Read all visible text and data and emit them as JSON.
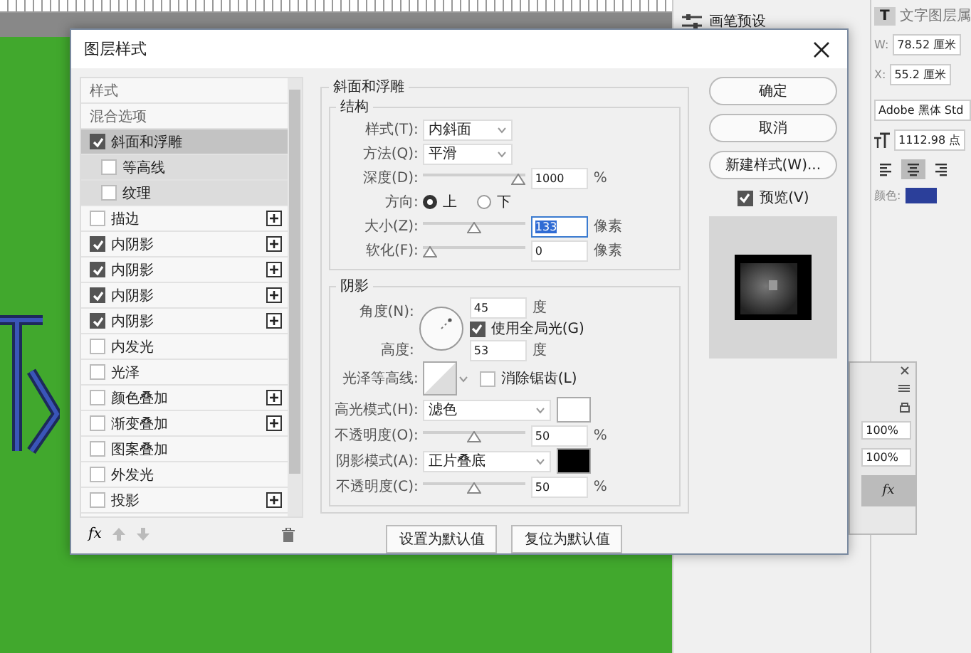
{
  "brush_panel": {
    "title": "画笔预设"
  },
  "properties": {
    "type_icon": "T",
    "title": "文字图层属",
    "w_label": "W:",
    "w_value": "78.52 厘米",
    "x_label": "X:",
    "x_value": "55.2 厘米",
    "font": "Adobe 黑体 Std",
    "size": "1112.98 点",
    "align": [
      {
        "kind": "left",
        "selected": false
      },
      {
        "kind": "center",
        "selected": true
      },
      {
        "kind": "right",
        "selected": false
      }
    ],
    "color_label": "颜色:",
    "color": "#2b3f9a"
  },
  "layers_panel": {
    "opacity": "100%",
    "fill": "100%",
    "fx": "fx"
  },
  "dialog": {
    "title": "图层样式",
    "styles": [
      {
        "kind": "header",
        "label": "样式",
        "selected": false
      },
      {
        "kind": "header",
        "label": "混合选项",
        "selected": false
      },
      {
        "kind": "effect",
        "label": "斜面和浮雕",
        "checked": true,
        "selected": true,
        "add_button": false,
        "children": [
          {
            "kind": "effect",
            "label": "等高线",
            "checked": false,
            "selected": false,
            "add_button": false
          },
          {
            "kind": "effect",
            "label": "纹理",
            "checked": false,
            "selected": false,
            "add_button": false
          }
        ]
      },
      {
        "kind": "effect",
        "label": "描边",
        "checked": false,
        "selected": false,
        "add_button": true
      },
      {
        "kind": "effect",
        "label": "内阴影",
        "checked": true,
        "selected": false,
        "add_button": true
      },
      {
        "kind": "effect",
        "label": "内阴影",
        "checked": true,
        "selected": false,
        "add_button": true
      },
      {
        "kind": "effect",
        "label": "内阴影",
        "checked": true,
        "selected": false,
        "add_button": true
      },
      {
        "kind": "effect",
        "label": "内阴影",
        "checked": true,
        "selected": false,
        "add_button": true
      },
      {
        "kind": "effect",
        "label": "内发光",
        "checked": false,
        "selected": false,
        "add_button": false
      },
      {
        "kind": "effect",
        "label": "光泽",
        "checked": false,
        "selected": false,
        "add_button": false
      },
      {
        "kind": "effect",
        "label": "颜色叠加",
        "checked": false,
        "selected": false,
        "add_button": true
      },
      {
        "kind": "effect",
        "label": "渐变叠加",
        "checked": false,
        "selected": false,
        "add_button": true
      },
      {
        "kind": "effect",
        "label": "图案叠加",
        "checked": false,
        "selected": false,
        "add_button": false
      },
      {
        "kind": "effect",
        "label": "外发光",
        "checked": false,
        "selected": false,
        "add_button": false
      },
      {
        "kind": "effect",
        "label": "投影",
        "checked": false,
        "selected": false,
        "add_button": true
      }
    ],
    "list_footer": {
      "fx": "fx"
    },
    "bevel": {
      "title": "斜面和浮雕",
      "groups": [
        {
          "title": "结构",
          "rows": [
            {
              "kind": "select",
              "label": "样式(T):",
              "value": "内斜面"
            },
            {
              "kind": "select",
              "label": "方法(Q):",
              "value": "平滑"
            },
            {
              "kind": "slider",
              "label": "深度(D):",
              "level": 1,
              "value": "1000",
              "unit": "%",
              "highlighted": false
            },
            {
              "kind": "radio",
              "label": "方向:",
              "options": [
                {
                  "label": "上",
                  "selected": true
                },
                {
                  "label": "下",
                  "selected": false
                }
              ]
            },
            {
              "kind": "slider",
              "label": "大小(Z):",
              "level": 0.5,
              "value": "133",
              "unit": "像素",
              "highlighted": true
            },
            {
              "kind": "slider",
              "label": "软化(F):",
              "level": 0,
              "value": "0",
              "unit": "像素",
              "highlighted": false
            }
          ]
        },
        {
          "title": "阴影",
          "rows": [
            {
              "kind": "angle",
              "label": "角度(N):",
              "value": "45",
              "unit": "度",
              "checkbox": {
                "label": "使用全局光(G)",
                "checked": true
              },
              "altitude_label": "高度:",
              "altitude": "53",
              "altitude_unit": "度"
            },
            {
              "kind": "contour",
              "label": "光泽等高线:",
              "checkbox": {
                "label": "消除锯齿(L)",
                "checked": false
              }
            },
            {
              "kind": "select_swatch",
              "label": "高光模式(H):",
              "value": "滤色",
              "color": "#ffffff"
            },
            {
              "kind": "slider",
              "label": "不透明度(O):",
              "level": 0.5,
              "value": "50",
              "unit": "%",
              "highlighted": false
            },
            {
              "kind": "select_swatch",
              "label": "阴影模式(A):",
              "value": "正片叠底",
              "color": "#000000"
            },
            {
              "kind": "slider",
              "label": "不透明度(C):",
              "level": 0.5,
              "value": "50",
              "unit": "%",
              "highlighted": false
            }
          ]
        }
      ],
      "buttons": [
        "设置为默认值",
        "复位为默认值"
      ]
    },
    "actions": [
      "确定",
      "取消",
      "新建样式(W)..."
    ],
    "preview": {
      "label": "预览(V)",
      "checked": true
    }
  }
}
